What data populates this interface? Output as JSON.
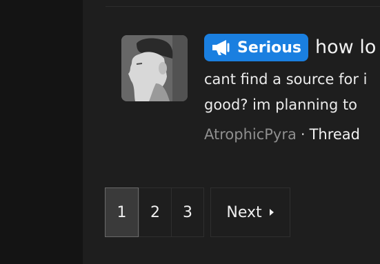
{
  "colors": {
    "page_background": "#141414",
    "content_background": "#1e1e1e",
    "badge_background": "#1a7fe0",
    "author_text": "#8f8f8f",
    "active_page_background": "#3a3a3a"
  },
  "thread": {
    "badge": {
      "icon": "megaphone-icon",
      "label": "Serious"
    },
    "title": "how lo",
    "snippet_line1": "cant find a source for i",
    "snippet_line2": "good? im planning to",
    "author": "AtrophicPyra",
    "separator": "·",
    "type": "Thread"
  },
  "pagination": {
    "pages": [
      "1",
      "2",
      "3"
    ],
    "current_page": "1",
    "next_label": "Next",
    "next_icon": "caret-right-icon"
  }
}
